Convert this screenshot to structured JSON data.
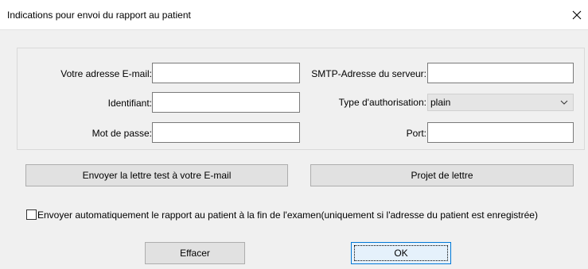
{
  "window": {
    "title": "Indications pour envoi du rapport au patient"
  },
  "form": {
    "email_label": "Votre adresse E-mail:",
    "email_value": "",
    "smtp_label": "SMTP-Adresse du serveur:",
    "smtp_value": "",
    "id_label": "Identifiant:",
    "id_value": "",
    "auth_label": "Type d'authorisation:",
    "auth_value": "plain",
    "password_label": "Mot de passe:",
    "password_value": "",
    "port_label": "Port:",
    "port_value": ""
  },
  "buttons": {
    "send_test": "Envoyer la lettre test à votre E-mail",
    "draft": "Projet de lettre",
    "clear": "Effacer",
    "ok": "OK"
  },
  "auto_send": {
    "label": "Envoyer automatiquement le rapport au patient à la fin de l'examen(uniquement si l'adresse du patient est enregistrée)",
    "checked": false
  },
  "icons": {
    "close": "close-icon",
    "dropdown": "chevron-down-icon"
  }
}
